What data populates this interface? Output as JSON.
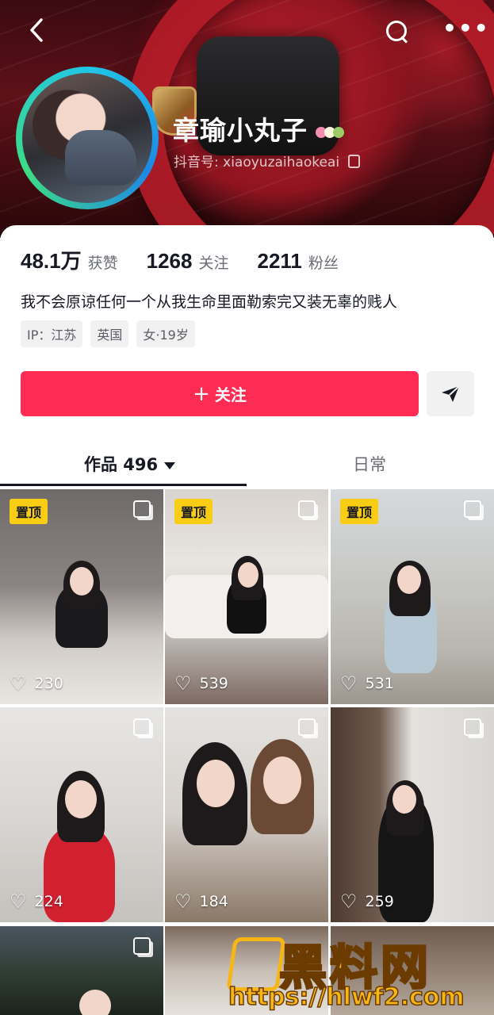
{
  "header": {
    "name": "章瑜小丸子",
    "handle_label": "抖音号:",
    "handle_value": "xiaoyuzaihaokeai"
  },
  "stats": [
    {
      "num": "48.1万",
      "label": "获赞"
    },
    {
      "num": "1268",
      "label": "关注"
    },
    {
      "num": "2211",
      "label": "粉丝"
    }
  ],
  "bio": "我不会原谅任何一个从我生命里面勒索完又装无辜的贱人",
  "tags": [
    "IP：江苏",
    "英国",
    "女·19岁"
  ],
  "follow_button": {
    "label": "关注"
  },
  "tabs": {
    "works": "作品 496",
    "daily": "日常"
  },
  "posts": [
    {
      "pinned": true,
      "pin_label": "置顶",
      "likes": "230"
    },
    {
      "pinned": true,
      "pin_label": "置顶",
      "likes": "539"
    },
    {
      "pinned": true,
      "pin_label": "置顶",
      "likes": "531"
    },
    {
      "pinned": false,
      "likes": "224"
    },
    {
      "pinned": false,
      "likes": "184"
    },
    {
      "pinned": false,
      "likes": "259"
    }
  ],
  "watermark": {
    "title": "黑料网",
    "url": "https://hlwf2.com"
  },
  "colors": {
    "accent": "#fe2c55",
    "pin_badge": "#facd15",
    "text": "#161823"
  }
}
